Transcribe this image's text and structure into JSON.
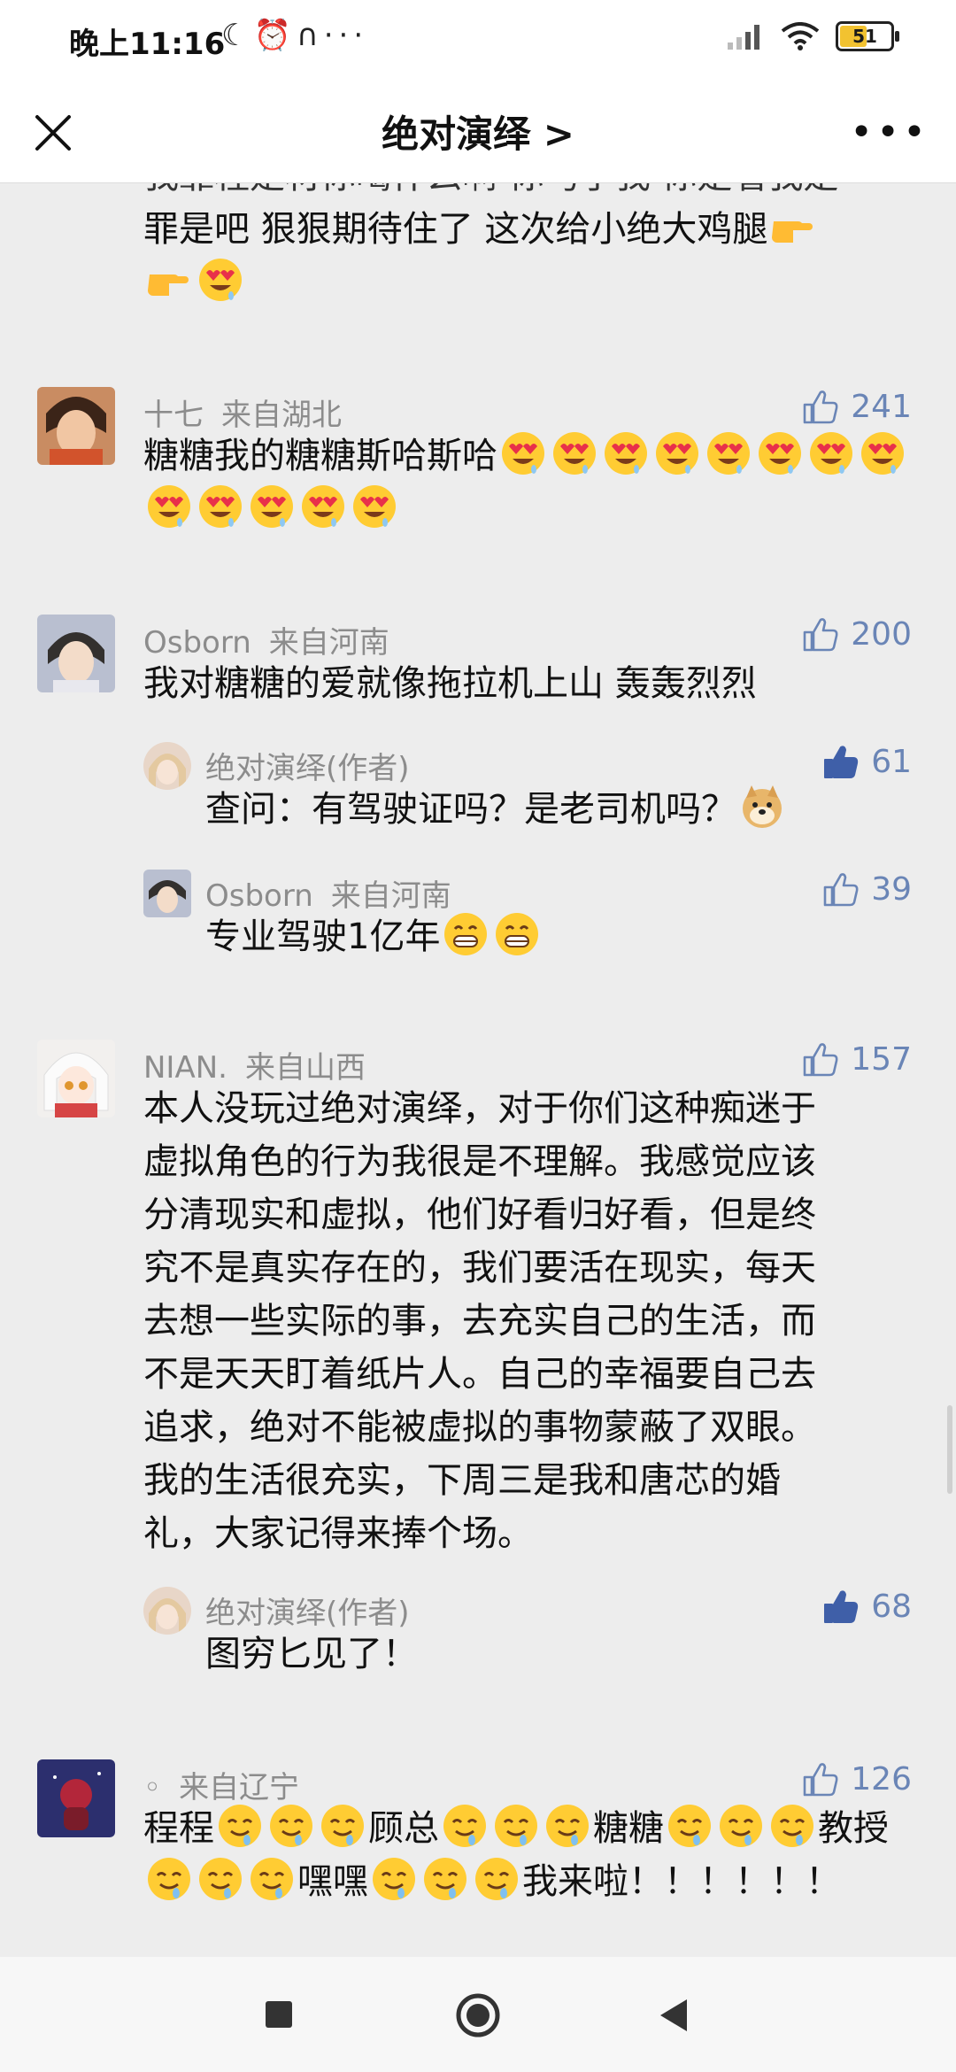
{
  "status": {
    "time": "晚上11:16",
    "battery": "51"
  },
  "header": {
    "title": "绝对演绎 >"
  },
  "partial": {
    "line1": "我靠程是材你喝什么啊 你马了我 你是看我是",
    "line2": "罪是吧 狠狠期待住了 这次给小绝大鸡腿",
    "emoji": [
      "point-right-emoji",
      "point-right-emoji",
      "heart-eyes-emoji"
    ]
  },
  "comments": [
    {
      "name": "十七",
      "location": "来自湖北",
      "likes": "241",
      "text": "糖糖我的糖糖斯哈斯哈",
      "emoji_count": 13
    },
    {
      "name": "Osborn",
      "location": "来自河南",
      "likes": "200",
      "text": "我对糖糖的爱就像拖拉机上山 轰轰烈烈",
      "replies": [
        {
          "name": "绝对演绎(作者)",
          "likes": "61",
          "text": "查问：有驾驶证吗？是老司机吗？",
          "liked": true
        },
        {
          "name": "Osborn",
          "location": "来自河南",
          "likes": "39",
          "text": "专业驾驶1亿年"
        }
      ]
    },
    {
      "name": "NIAN.",
      "location": "来自山西",
      "likes": "157",
      "lines": [
        "本人没玩过绝对演绎，对于你们这种痴迷于",
        "虚拟角色的行为我很是不理解。我感觉应该",
        "分清现实和虚拟，他们好看归好看，但是终",
        "究不是真实存在的，我们要活在现实，每天",
        "去想一些实际的事，去充实自己的生活，而",
        "不是天天盯着纸片人。自己的幸福要自己去",
        "追求，绝对不能被虚拟的事物蒙蔽了双眼。",
        "我的生活很充实，下周三是我和唐芯的婚",
        "礼，大家记得来捧个场。"
      ],
      "replies": [
        {
          "name": "绝对演绎(作者)",
          "likes": "68",
          "text": "图穷匕见了！",
          "liked": true
        }
      ]
    },
    {
      "name": "◦",
      "location": "来自辽宁",
      "likes": "126",
      "seg": [
        "程程",
        "顾总",
        "糖糖",
        "教授",
        "嘿嘿",
        "我来啦！！！！！！"
      ]
    }
  ]
}
